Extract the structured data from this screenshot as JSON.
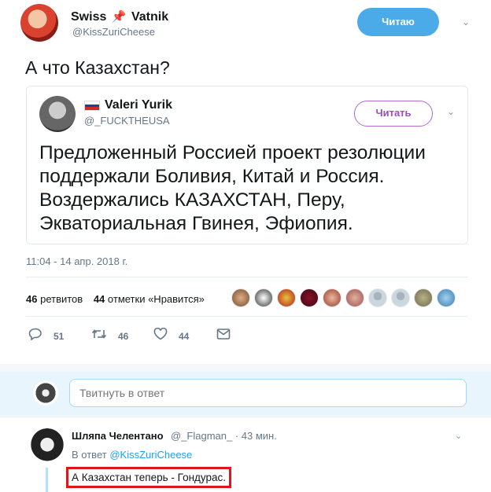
{
  "tweet": {
    "author_name_part1": "Swiss",
    "author_name_part2": "Vatnik",
    "author_handle": "@KissZuriCheese",
    "follow_label": "Читаю",
    "text": "А что Казахстан?",
    "timestamp": "11:04 - 14 апр. 2018 г.",
    "retweets_count": "46",
    "retweets_label": "ретвитов",
    "likes_count": "44",
    "likes_label": "отметки «Нравится»",
    "actions": {
      "replies": "51",
      "retweets": "46",
      "likes": "44"
    }
  },
  "quote": {
    "author_name": "Valeri Yurik",
    "author_handle": "@_FUCKTHEUSA",
    "follow_label": "Читать",
    "text": "Предложенный Россией проект резолюции поддержали Боливия, Китай и Россия. Воздержались КАЗАХСТАН, Перу, Экваториальная Гвинея, Эфиопия."
  },
  "reply_box": {
    "placeholder": "Твитнуть в ответ"
  },
  "reply": {
    "author_name": "Шляпа Челентано",
    "meta": "@_Flagman_ · 43 мин.",
    "reply_to_label": "В ответ",
    "reply_to_handle": "@KissZuriCheese",
    "text": "А Казахстан теперь - Гондурас."
  },
  "colors": {
    "accent": "#1da1f2",
    "follow_bg": "#4aabe8",
    "quote_follow": "#9b4cc0",
    "highlight": "#e0151c"
  },
  "icons": {
    "pin": "pushpin-icon",
    "reply": "reply-icon",
    "retweet": "retweet-icon",
    "like": "heart-icon",
    "dm": "message-icon",
    "chevron": "chevron-down-icon"
  }
}
